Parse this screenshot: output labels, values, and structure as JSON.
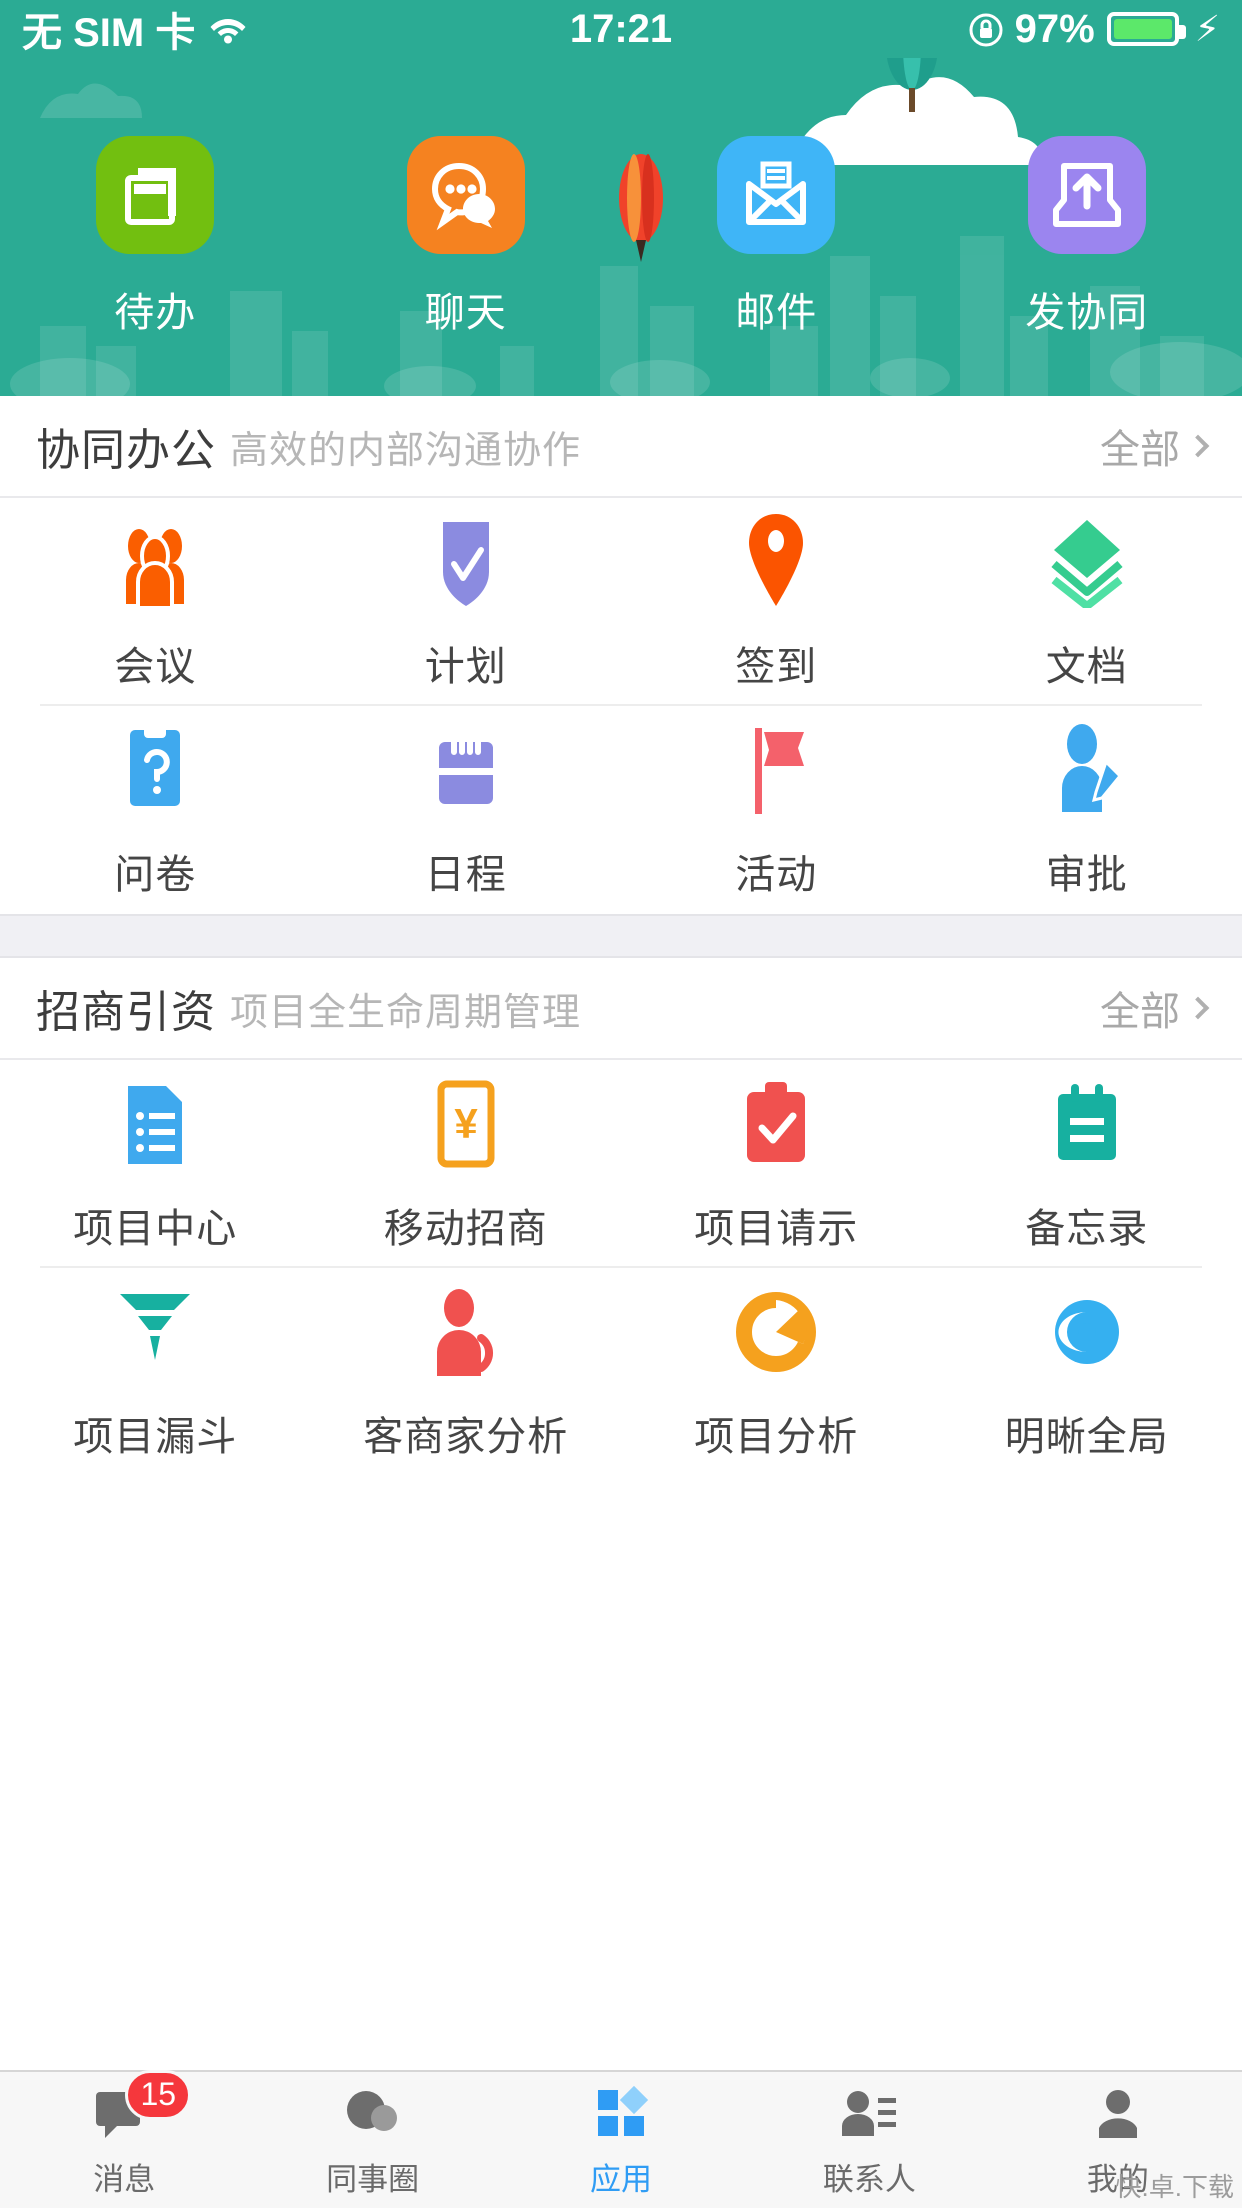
{
  "statusbar": {
    "carrier": "无 SIM 卡",
    "wifi_icon": "wifi-icon",
    "time": "17:21",
    "rotation_lock_icon": "rotation-lock-icon",
    "battery_percent": "97%",
    "battery_icon": "battery-icon",
    "charging_icon": "charging-bolt-icon",
    "bg_color": "#2bab94"
  },
  "hero": {
    "bg_color": "#2bab94",
    "shortcuts": [
      {
        "label": "待办",
        "icon": "documents-icon",
        "tile_color": "#72bf10"
      },
      {
        "label": "聊天",
        "icon": "chat-bubbles-icon",
        "tile_color": "#f58220"
      },
      {
        "label": "邮件",
        "icon": "envelope-icon",
        "tile_color": "#3fb5f7"
      },
      {
        "label": "发协同",
        "icon": "upload-tray-icon",
        "tile_color": "#9b85ef"
      }
    ]
  },
  "sections": [
    {
      "title": "协同办公",
      "subtitle": "高效的内部沟通协作",
      "all_label": "全部",
      "rows": [
        [
          {
            "label": "会议",
            "icon": "people-icon",
            "color": "#fa5e00"
          },
          {
            "label": "计划",
            "icon": "shield-check-icon",
            "color": "#8b8be0"
          },
          {
            "label": "签到",
            "icon": "location-pin-icon",
            "color": "#fb5400"
          },
          {
            "label": "文档",
            "icon": "layers-icon",
            "color": "#35cc8f"
          }
        ],
        [
          {
            "label": "问卷",
            "icon": "clipboard-question-icon",
            "color": "#3fa9ee"
          },
          {
            "label": "日程",
            "icon": "calendar-icon",
            "color": "#8b8be0"
          },
          {
            "label": "活动",
            "icon": "flag-icon",
            "color": "#f4616b"
          },
          {
            "label": "审批",
            "icon": "person-pen-icon",
            "color": "#3fa9ee"
          }
        ]
      ]
    },
    {
      "title": "招商引资",
      "subtitle": "项目全生命周期管理",
      "all_label": "全部",
      "rows": [
        [
          {
            "label": "项目中心",
            "icon": "document-list-icon",
            "color": "#3fa9ee"
          },
          {
            "label": "移动招商",
            "icon": "money-tablet-icon",
            "color": "#f5a11e"
          },
          {
            "label": "项目请示",
            "icon": "checkbox-card-icon",
            "color": "#f0514f"
          },
          {
            "label": "备忘录",
            "icon": "memo-icon",
            "color": "#17b0a0"
          }
        ],
        [
          {
            "label": "项目漏斗",
            "icon": "funnel-icon",
            "color": "#17b0a0"
          },
          {
            "label": "客商家分析",
            "icon": "customer-icon",
            "color": "#f0514f"
          },
          {
            "label": "项目分析",
            "icon": "donut-chart-icon",
            "color": "#f5a11e"
          },
          {
            "label": "明晰全局",
            "icon": "eye-globe-icon",
            "color": "#35b0f0"
          }
        ]
      ]
    }
  ],
  "tabbar": {
    "items": [
      {
        "label": "消息",
        "icon": "message-icon",
        "badge": "15",
        "active": false
      },
      {
        "label": "同事圈",
        "icon": "circle-icon",
        "badge": "",
        "active": false
      },
      {
        "label": "应用",
        "icon": "apps-icon",
        "badge": "",
        "active": true
      },
      {
        "label": "联系人",
        "icon": "contacts-icon",
        "badge": "",
        "active": false
      },
      {
        "label": "我的",
        "icon": "profile-icon",
        "badge": "",
        "active": false
      }
    ],
    "active_color": "#2f9cf4"
  },
  "watermark": "快.卓.下载"
}
